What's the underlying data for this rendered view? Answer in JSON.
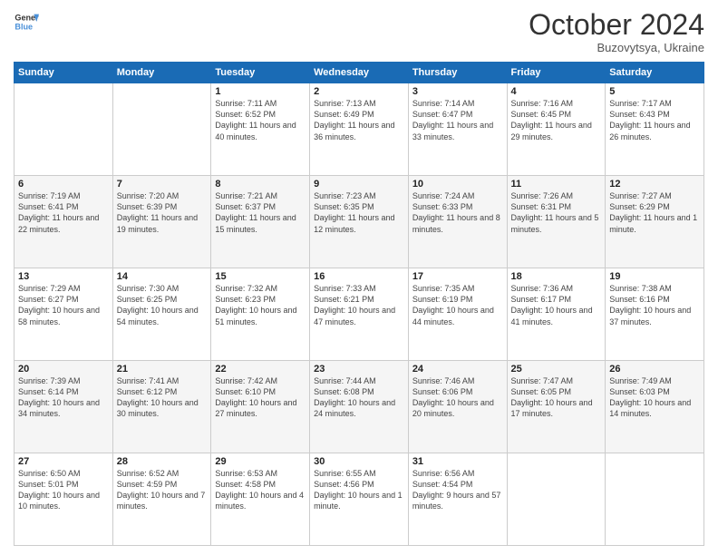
{
  "header": {
    "logo_line1": "General",
    "logo_line2": "Blue",
    "month": "October 2024",
    "location": "Buzovytsya, Ukraine"
  },
  "weekdays": [
    "Sunday",
    "Monday",
    "Tuesday",
    "Wednesday",
    "Thursday",
    "Friday",
    "Saturday"
  ],
  "weeks": [
    [
      {
        "day": "",
        "sunrise": "",
        "sunset": "",
        "daylight": ""
      },
      {
        "day": "",
        "sunrise": "",
        "sunset": "",
        "daylight": ""
      },
      {
        "day": "1",
        "sunrise": "Sunrise: 7:11 AM",
        "sunset": "Sunset: 6:52 PM",
        "daylight": "Daylight: 11 hours and 40 minutes."
      },
      {
        "day": "2",
        "sunrise": "Sunrise: 7:13 AM",
        "sunset": "Sunset: 6:49 PM",
        "daylight": "Daylight: 11 hours and 36 minutes."
      },
      {
        "day": "3",
        "sunrise": "Sunrise: 7:14 AM",
        "sunset": "Sunset: 6:47 PM",
        "daylight": "Daylight: 11 hours and 33 minutes."
      },
      {
        "day": "4",
        "sunrise": "Sunrise: 7:16 AM",
        "sunset": "Sunset: 6:45 PM",
        "daylight": "Daylight: 11 hours and 29 minutes."
      },
      {
        "day": "5",
        "sunrise": "Sunrise: 7:17 AM",
        "sunset": "Sunset: 6:43 PM",
        "daylight": "Daylight: 11 hours and 26 minutes."
      }
    ],
    [
      {
        "day": "6",
        "sunrise": "Sunrise: 7:19 AM",
        "sunset": "Sunset: 6:41 PM",
        "daylight": "Daylight: 11 hours and 22 minutes."
      },
      {
        "day": "7",
        "sunrise": "Sunrise: 7:20 AM",
        "sunset": "Sunset: 6:39 PM",
        "daylight": "Daylight: 11 hours and 19 minutes."
      },
      {
        "day": "8",
        "sunrise": "Sunrise: 7:21 AM",
        "sunset": "Sunset: 6:37 PM",
        "daylight": "Daylight: 11 hours and 15 minutes."
      },
      {
        "day": "9",
        "sunrise": "Sunrise: 7:23 AM",
        "sunset": "Sunset: 6:35 PM",
        "daylight": "Daylight: 11 hours and 12 minutes."
      },
      {
        "day": "10",
        "sunrise": "Sunrise: 7:24 AM",
        "sunset": "Sunset: 6:33 PM",
        "daylight": "Daylight: 11 hours and 8 minutes."
      },
      {
        "day": "11",
        "sunrise": "Sunrise: 7:26 AM",
        "sunset": "Sunset: 6:31 PM",
        "daylight": "Daylight: 11 hours and 5 minutes."
      },
      {
        "day": "12",
        "sunrise": "Sunrise: 7:27 AM",
        "sunset": "Sunset: 6:29 PM",
        "daylight": "Daylight: 11 hours and 1 minute."
      }
    ],
    [
      {
        "day": "13",
        "sunrise": "Sunrise: 7:29 AM",
        "sunset": "Sunset: 6:27 PM",
        "daylight": "Daylight: 10 hours and 58 minutes."
      },
      {
        "day": "14",
        "sunrise": "Sunrise: 7:30 AM",
        "sunset": "Sunset: 6:25 PM",
        "daylight": "Daylight: 10 hours and 54 minutes."
      },
      {
        "day": "15",
        "sunrise": "Sunrise: 7:32 AM",
        "sunset": "Sunset: 6:23 PM",
        "daylight": "Daylight: 10 hours and 51 minutes."
      },
      {
        "day": "16",
        "sunrise": "Sunrise: 7:33 AM",
        "sunset": "Sunset: 6:21 PM",
        "daylight": "Daylight: 10 hours and 47 minutes."
      },
      {
        "day": "17",
        "sunrise": "Sunrise: 7:35 AM",
        "sunset": "Sunset: 6:19 PM",
        "daylight": "Daylight: 10 hours and 44 minutes."
      },
      {
        "day": "18",
        "sunrise": "Sunrise: 7:36 AM",
        "sunset": "Sunset: 6:17 PM",
        "daylight": "Daylight: 10 hours and 41 minutes."
      },
      {
        "day": "19",
        "sunrise": "Sunrise: 7:38 AM",
        "sunset": "Sunset: 6:16 PM",
        "daylight": "Daylight: 10 hours and 37 minutes."
      }
    ],
    [
      {
        "day": "20",
        "sunrise": "Sunrise: 7:39 AM",
        "sunset": "Sunset: 6:14 PM",
        "daylight": "Daylight: 10 hours and 34 minutes."
      },
      {
        "day": "21",
        "sunrise": "Sunrise: 7:41 AM",
        "sunset": "Sunset: 6:12 PM",
        "daylight": "Daylight: 10 hours and 30 minutes."
      },
      {
        "day": "22",
        "sunrise": "Sunrise: 7:42 AM",
        "sunset": "Sunset: 6:10 PM",
        "daylight": "Daylight: 10 hours and 27 minutes."
      },
      {
        "day": "23",
        "sunrise": "Sunrise: 7:44 AM",
        "sunset": "Sunset: 6:08 PM",
        "daylight": "Daylight: 10 hours and 24 minutes."
      },
      {
        "day": "24",
        "sunrise": "Sunrise: 7:46 AM",
        "sunset": "Sunset: 6:06 PM",
        "daylight": "Daylight: 10 hours and 20 minutes."
      },
      {
        "day": "25",
        "sunrise": "Sunrise: 7:47 AM",
        "sunset": "Sunset: 6:05 PM",
        "daylight": "Daylight: 10 hours and 17 minutes."
      },
      {
        "day": "26",
        "sunrise": "Sunrise: 7:49 AM",
        "sunset": "Sunset: 6:03 PM",
        "daylight": "Daylight: 10 hours and 14 minutes."
      }
    ],
    [
      {
        "day": "27",
        "sunrise": "Sunrise: 6:50 AM",
        "sunset": "Sunset: 5:01 PM",
        "daylight": "Daylight: 10 hours and 10 minutes."
      },
      {
        "day": "28",
        "sunrise": "Sunrise: 6:52 AM",
        "sunset": "Sunset: 4:59 PM",
        "daylight": "Daylight: 10 hours and 7 minutes."
      },
      {
        "day": "29",
        "sunrise": "Sunrise: 6:53 AM",
        "sunset": "Sunset: 4:58 PM",
        "daylight": "Daylight: 10 hours and 4 minutes."
      },
      {
        "day": "30",
        "sunrise": "Sunrise: 6:55 AM",
        "sunset": "Sunset: 4:56 PM",
        "daylight": "Daylight: 10 hours and 1 minute."
      },
      {
        "day": "31",
        "sunrise": "Sunrise: 6:56 AM",
        "sunset": "Sunset: 4:54 PM",
        "daylight": "Daylight: 9 hours and 57 minutes."
      },
      {
        "day": "",
        "sunrise": "",
        "sunset": "",
        "daylight": ""
      },
      {
        "day": "",
        "sunrise": "",
        "sunset": "",
        "daylight": ""
      }
    ]
  ]
}
